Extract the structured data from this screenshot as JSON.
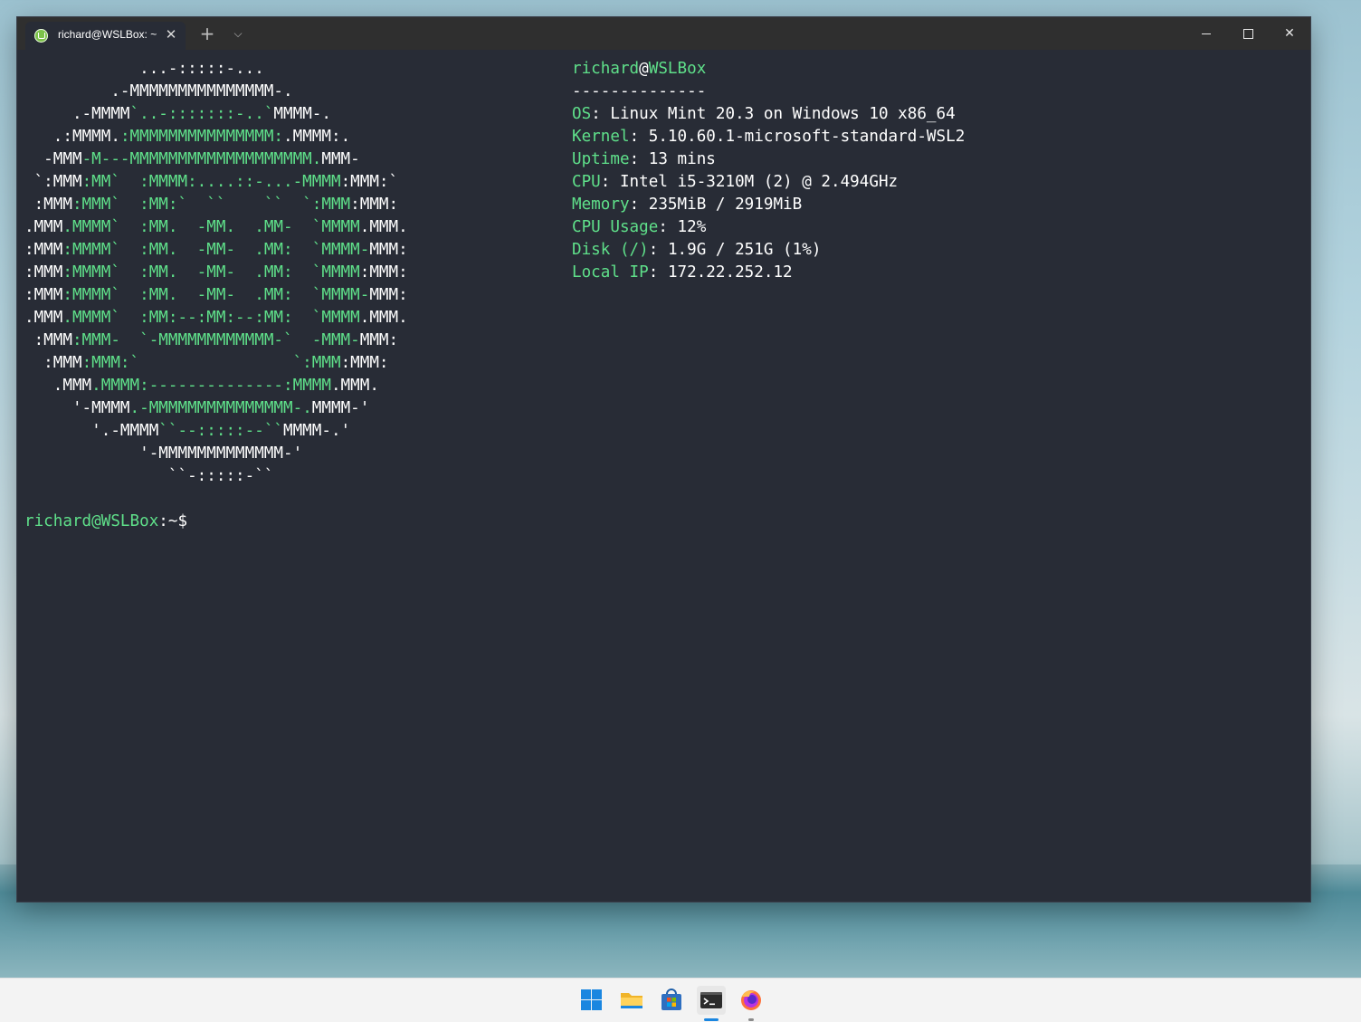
{
  "window": {
    "tab_title": "richard@WSLBox: ~",
    "tab_icon": "linux-mint-icon",
    "tab_close": "✕",
    "new_tab": "+",
    "dropdown": "⌵",
    "close_button": "✕"
  },
  "terminal": {
    "accent_color": "#5fe08a",
    "background": "#282c36",
    "ascii_art": [
      [
        [
          "w",
          "            ...-:::::-..."
        ]
      ],
      [
        [
          "w",
          "         .-MMMMMMMMMMMMMMM-."
        ]
      ],
      [
        [
          "w",
          "     .-MMMM"
        ],
        [
          "g",
          "`..-:::::::-..`"
        ],
        [
          "w",
          "MMMM-."
        ]
      ],
      [
        [
          "w",
          "   .:MMMM."
        ],
        [
          "g",
          ":MMMMMMMMMMMMMMM:"
        ],
        [
          "w",
          ".MMMM:."
        ]
      ],
      [
        [
          "w",
          "  -MMM"
        ],
        [
          "g",
          "-M---MMMMMMMMMMMMMMMMMMM."
        ],
        [
          "w",
          "MMM-"
        ]
      ],
      [
        [
          "w",
          " `:MMM"
        ],
        [
          "g",
          ":MM`  :MMMM:....::-...-MMMM"
        ],
        [
          "w",
          ":MMM:`"
        ]
      ],
      [
        [
          "w",
          " :MMM"
        ],
        [
          "g",
          ":MMM`  :MM:`  ``    ``  `:MMM"
        ],
        [
          "w",
          ":MMM:"
        ]
      ],
      [
        [
          "w",
          ".MMM"
        ],
        [
          "g",
          ".MMMM`  :MM.  -MM.  .MM-  `MMMM"
        ],
        [
          "w",
          ".MMM."
        ]
      ],
      [
        [
          "w",
          ":MMM"
        ],
        [
          "g",
          ":MMMM`  :MM.  -MM-  .MM:  `MMMM-"
        ],
        [
          "w",
          "MMM:"
        ]
      ],
      [
        [
          "w",
          ":MMM"
        ],
        [
          "g",
          ":MMMM`  :MM.  -MM-  .MM:  `MMMM"
        ],
        [
          "w",
          ":MMM:"
        ]
      ],
      [
        [
          "w",
          ":MMM"
        ],
        [
          "g",
          ":MMMM`  :MM.  -MM-  .MM:  `MMMM-"
        ],
        [
          "w",
          "MMM:"
        ]
      ],
      [
        [
          "w",
          ".MMM"
        ],
        [
          "g",
          ".MMMM`  :MM:--:MM:--:MM:  `MMMM"
        ],
        [
          "w",
          ".MMM."
        ]
      ],
      [
        [
          "w",
          " :MMM"
        ],
        [
          "g",
          ":MMM-  `-MMMMMMMMMMMM-`  -MMM-"
        ],
        [
          "w",
          "MMM:"
        ]
      ],
      [
        [
          "w",
          "  :MMM"
        ],
        [
          "g",
          ":MMM:`                `:MMM"
        ],
        [
          "w",
          ":MMM:"
        ]
      ],
      [
        [
          "w",
          "   .MMM"
        ],
        [
          "g",
          ".MMMM:--------------:MMMM"
        ],
        [
          "w",
          ".MMM."
        ]
      ],
      [
        [
          "w",
          "     '-MMMM"
        ],
        [
          "g",
          ".-MMMMMMMMMMMMMMM-."
        ],
        [
          "w",
          "MMMM-'"
        ]
      ],
      [
        [
          "w",
          "       '.-MMMM"
        ],
        [
          "g",
          "``--:::::--``"
        ],
        [
          "w",
          "MMMM-.'"
        ]
      ],
      [
        [
          "w",
          "            '-MMMMMMMMMMMMM-'"
        ]
      ],
      [
        [
          "w",
          "               ``-:::::-``"
        ]
      ]
    ],
    "header_user": "richard",
    "header_at": "@",
    "header_host": "WSLBox",
    "separator": "--------------",
    "info": [
      {
        "key": "OS",
        "value": "Linux Mint 20.3 on Windows 10 x86_64"
      },
      {
        "key": "Kernel",
        "value": "5.10.60.1-microsoft-standard-WSL2"
      },
      {
        "key": "Uptime",
        "value": "13 mins"
      },
      {
        "key": "CPU",
        "value": "Intel i5-3210M (2) @ 2.494GHz"
      },
      {
        "key": "Memory",
        "value": "235MiB / 2919MiB"
      },
      {
        "key": "CPU Usage",
        "value": "12%"
      },
      {
        "key": "Disk (/)",
        "value": "1.9G / 251G (1%)"
      },
      {
        "key": "Local IP",
        "value": "172.22.252.12"
      }
    ],
    "prompt_user_host": "richard@WSLBox",
    "prompt_path": ":~$"
  },
  "taskbar": {
    "items": [
      {
        "name": "start-button",
        "icon": "windows-logo-icon"
      },
      {
        "name": "file-explorer",
        "icon": "folder-icon"
      },
      {
        "name": "microsoft-store",
        "icon": "store-bag-icon"
      },
      {
        "name": "windows-terminal",
        "icon": "terminal-icon",
        "active": true
      },
      {
        "name": "firefox",
        "icon": "firefox-icon",
        "running": true
      }
    ]
  }
}
